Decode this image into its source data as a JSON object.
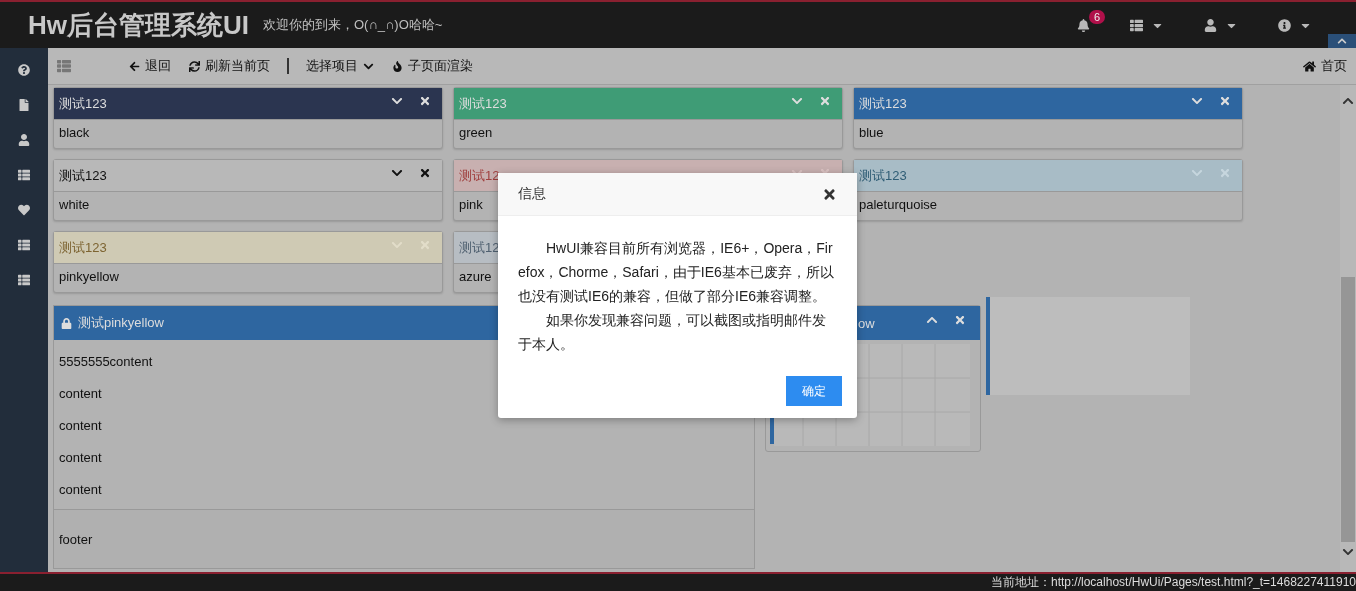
{
  "header": {
    "logo": "Hw后台管理系统UI",
    "welcome": "欢迎你的到来，O(∩_∩)O哈哈~",
    "notifications": {
      "count": "6"
    },
    "menus": [
      {
        "kind": "list"
      },
      {
        "kind": "user"
      },
      {
        "kind": "info"
      }
    ]
  },
  "sidebar": {
    "items": [
      {
        "kind": "help"
      },
      {
        "kind": "file"
      },
      {
        "kind": "user"
      },
      {
        "kind": "list"
      },
      {
        "kind": "heart"
      },
      {
        "kind": "list"
      },
      {
        "kind": "list"
      }
    ]
  },
  "toolbar": {
    "items": [
      {
        "kind": "back",
        "label": "退回"
      },
      {
        "kind": "refresh",
        "label": "刷新当前页"
      },
      {
        "kind": "select",
        "label": "选择项目"
      },
      {
        "kind": "render",
        "label": "子页面渲染"
      }
    ],
    "home": "首页"
  },
  "panels": [
    {
      "title": "测试123",
      "body": "black",
      "kind": "dark",
      "color": "#2b3550",
      "controls": true
    },
    {
      "title": "测试123",
      "body": "green",
      "kind": "dark",
      "color": "#3f9c76",
      "controls": true
    },
    {
      "title": "测试123",
      "body": "blue",
      "kind": "dark",
      "color": "#2e66a0",
      "controls": true
    },
    {
      "title": "测试123",
      "body": "white",
      "kind": "plain",
      "color": "#b8b8b8",
      "controls": true
    },
    {
      "title": "测试12",
      "body": "pink",
      "kind": "danger",
      "color": "#c8b0b0",
      "controls": true
    },
    {
      "title": "测试123",
      "body": "paleturquoise",
      "kind": "info",
      "color": "#a8bcc6",
      "controls": true
    },
    {
      "title": "测试123",
      "body": "pinkyellow",
      "kind": "warning",
      "color": "#cfcab4",
      "controls": true
    },
    {
      "title": "测试12",
      "body": "azure",
      "kind": "muted",
      "color": "#b7bdc3"
    }
  ],
  "big_panel": {
    "title": "测试pinkyellow",
    "locked": true,
    "lines": [
      "5555555content",
      "content",
      "content",
      "content",
      "content"
    ],
    "footer": "footer"
  },
  "small_panel": {
    "title": "ow"
  },
  "dialog": {
    "title": "信息",
    "paragraphs": [
      "HwUI兼容目前所有浏览器，IE6+，Opera，Firefox，Chorme，Safari，由于IE6基本已废弃，所以也没有测试IE6的兼容，但做了部分IE6兼容调整。",
      "如果你发现兼容问题，可以截图或指明邮件发于本人。"
    ],
    "button": "确定"
  },
  "status_bar": {
    "address": "当前地址：http://localhost/HwUi/Pages/test.html?_t=1468227411910"
  }
}
